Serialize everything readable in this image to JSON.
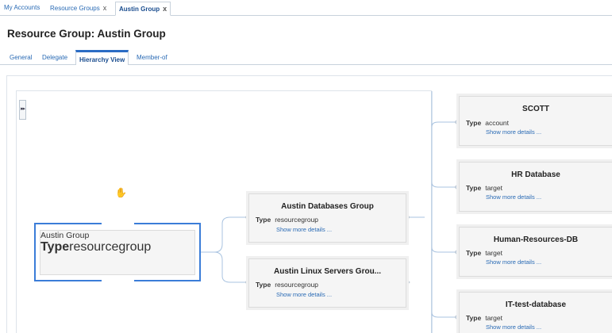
{
  "top_tabs": {
    "my_accounts": "My Accounts",
    "resource_groups": "Resource Groups",
    "austin_group": "Austin Group",
    "close_glyph": "x"
  },
  "page_title": "Resource Group: Austin Group",
  "sub_tabs": {
    "general": "General",
    "delegate": "Delegate",
    "hierarchy_view": "Hierarchy View",
    "member_of": "Member-of"
  },
  "hierarchy": {
    "type_label": "Type",
    "more_label": "Show more details ...",
    "root": {
      "name": "Austin Group",
      "type": "resourcegroup"
    },
    "groups": [
      {
        "name": "Austin Databases Group",
        "type": "resourcegroup"
      },
      {
        "name": "Austin Linux Servers Grou...",
        "type": "resourcegroup"
      }
    ],
    "targets": [
      {
        "name": "SCOTT",
        "type": "account"
      },
      {
        "name": "HR Database",
        "type": "target"
      },
      {
        "name": "Human-Resources-DB",
        "type": "target"
      },
      {
        "name": "IT-test-database",
        "type": "target"
      }
    ]
  },
  "colors": {
    "link": "#2a6bb5",
    "selected_border": "#3b7dd8",
    "connector": "#a9c3e0"
  },
  "icons": [
    "expand-icon",
    "hand-cursor-icon",
    "close-icon"
  ]
}
